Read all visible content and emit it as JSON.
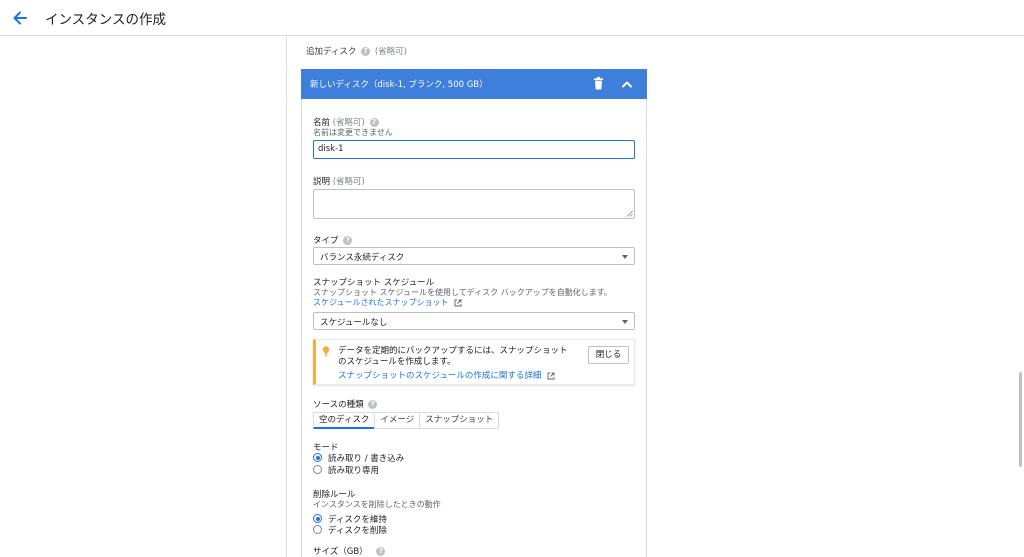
{
  "header": {
    "title": "インスタンスの作成"
  },
  "section": {
    "title": "追加ディスク",
    "optional": "(省略可)"
  },
  "disk_card": {
    "title": "新しいディスク（disk-1, ブランク, 500 GB）",
    "name": {
      "label": "名前",
      "optional": "(省略可)",
      "hint": "名前は変更できません",
      "value": "disk-1"
    },
    "description": {
      "label": "説明",
      "optional": "(省略可)",
      "value": ""
    },
    "type": {
      "label": "タイプ",
      "selected": "バランス永続ディスク"
    },
    "snapshot_schedule": {
      "label": "スナップショット スケジュール",
      "hint": "スナップショット スケジュールを使用してディスク バックアップを自動化します。",
      "link": "スケジュールされたスナップショット",
      "selected": "スケジュールなし"
    },
    "notice": {
      "text": "データを定期的にバックアップするには、スナップショットのスケジュールを作成します。",
      "link": "スナップショットのスケジュールの作成に関する詳細",
      "close_label": "閉じる"
    },
    "source_type": {
      "label": "ソースの種類",
      "tabs": [
        "空のディスク",
        "イメージ",
        "スナップショット"
      ],
      "active_index": 0
    },
    "mode": {
      "label": "モード",
      "options": [
        "読み取り / 書き込み",
        "読み取り専用"
      ],
      "selected_index": 0
    },
    "deletion_rule": {
      "label": "削除ルール",
      "hint": "インスタンスを削除したときの動作",
      "options": [
        "ディスクを維持",
        "ディスクを削除"
      ],
      "selected_index": 0
    },
    "size": {
      "label": "サイズ（GB）"
    }
  },
  "colors": {
    "accent": "#3f7fdc",
    "link": "#1a73e8",
    "notice_bar": "#f5ae3d"
  },
  "icons": {
    "back": "back-arrow-icon",
    "delete": "trash-icon",
    "collapse": "chevron-up-icon",
    "help": "help-icon",
    "external": "external-link-icon",
    "tip": "lightbulb-icon"
  }
}
